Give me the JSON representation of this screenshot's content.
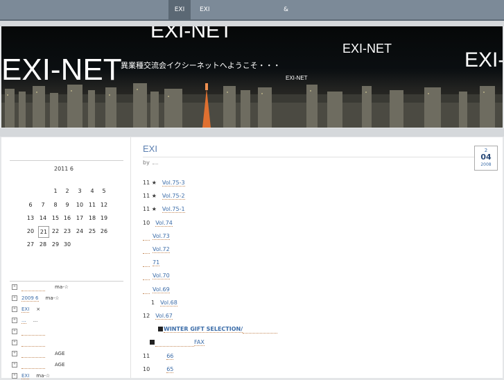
{
  "nav": {
    "items": [
      "EXI",
      "EXI",
      "&"
    ]
  },
  "banner": {
    "titles": [
      "EXI-NET",
      "EXI-NET",
      "EXI-NET",
      "EXI-NET",
      "EXI-NET"
    ],
    "tagline": "異業種交流会イクシーネットへようこそ・・・"
  },
  "calendar": {
    "title": "2011  6",
    "weeks": [
      [
        "",
        "",
        "",
        "1",
        "2",
        "3",
        "4",
        "5"
      ],
      [
        "",
        "6",
        "7",
        "8",
        "9",
        "10",
        "11",
        "12"
      ],
      [
        "",
        "13",
        "14",
        "15",
        "16",
        "17",
        "18",
        "19"
      ],
      [
        "",
        "20",
        "21",
        "22",
        "23",
        "24",
        "25",
        "26"
      ],
      [
        "",
        "27",
        "28",
        "29",
        "30",
        "",
        "",
        ""
      ]
    ],
    "today": "21"
  },
  "archives": [
    {
      "link": "",
      "text": "ma-☆"
    },
    {
      "link": "2009 6",
      "text": "ma-☆"
    },
    {
      "link": "EXI",
      "text": "×"
    },
    {
      "link": "...",
      "text": "..."
    },
    {
      "link": "",
      "text": ""
    },
    {
      "link": "",
      "text": ""
    },
    {
      "link": "",
      "text": "AGE"
    },
    {
      "link": "",
      "text": "AGE"
    },
    {
      "link": "EXI",
      "text": "ma-☆"
    }
  ],
  "post": {
    "title": "EXI",
    "by": "by",
    "date": {
      "month": "2",
      "day": "04",
      "year": "2008"
    },
    "lines": [
      {
        "prefix": "11  ★",
        "link": "Vol.75-3"
      },
      {
        "prefix": "11  ★",
        "link": "Vol.75-2"
      },
      {
        "prefix": "11  ★",
        "link": "Vol.75-1"
      },
      {
        "prefix": "10",
        "link": "Vol.74"
      },
      {
        "prefix": "",
        "link": "Vol.73"
      },
      {
        "prefix": "",
        "link": "Vol.72"
      },
      {
        "prefix": "",
        "link": "71"
      },
      {
        "prefix": "",
        "link": "Vol.70"
      },
      {
        "prefix": "",
        "link": "Vol.69"
      },
      {
        "prefix": "1",
        "link": "Vol.68"
      },
      {
        "prefix": "12",
        "link": "Vol.67"
      },
      {
        "prefix": "",
        "link": "WINTER GIFT SELECTION/"
      },
      {
        "prefix": "",
        "link": "FAX"
      },
      {
        "prefix": "11",
        "link": "66"
      },
      {
        "prefix": "10",
        "link": "65"
      }
    ]
  }
}
